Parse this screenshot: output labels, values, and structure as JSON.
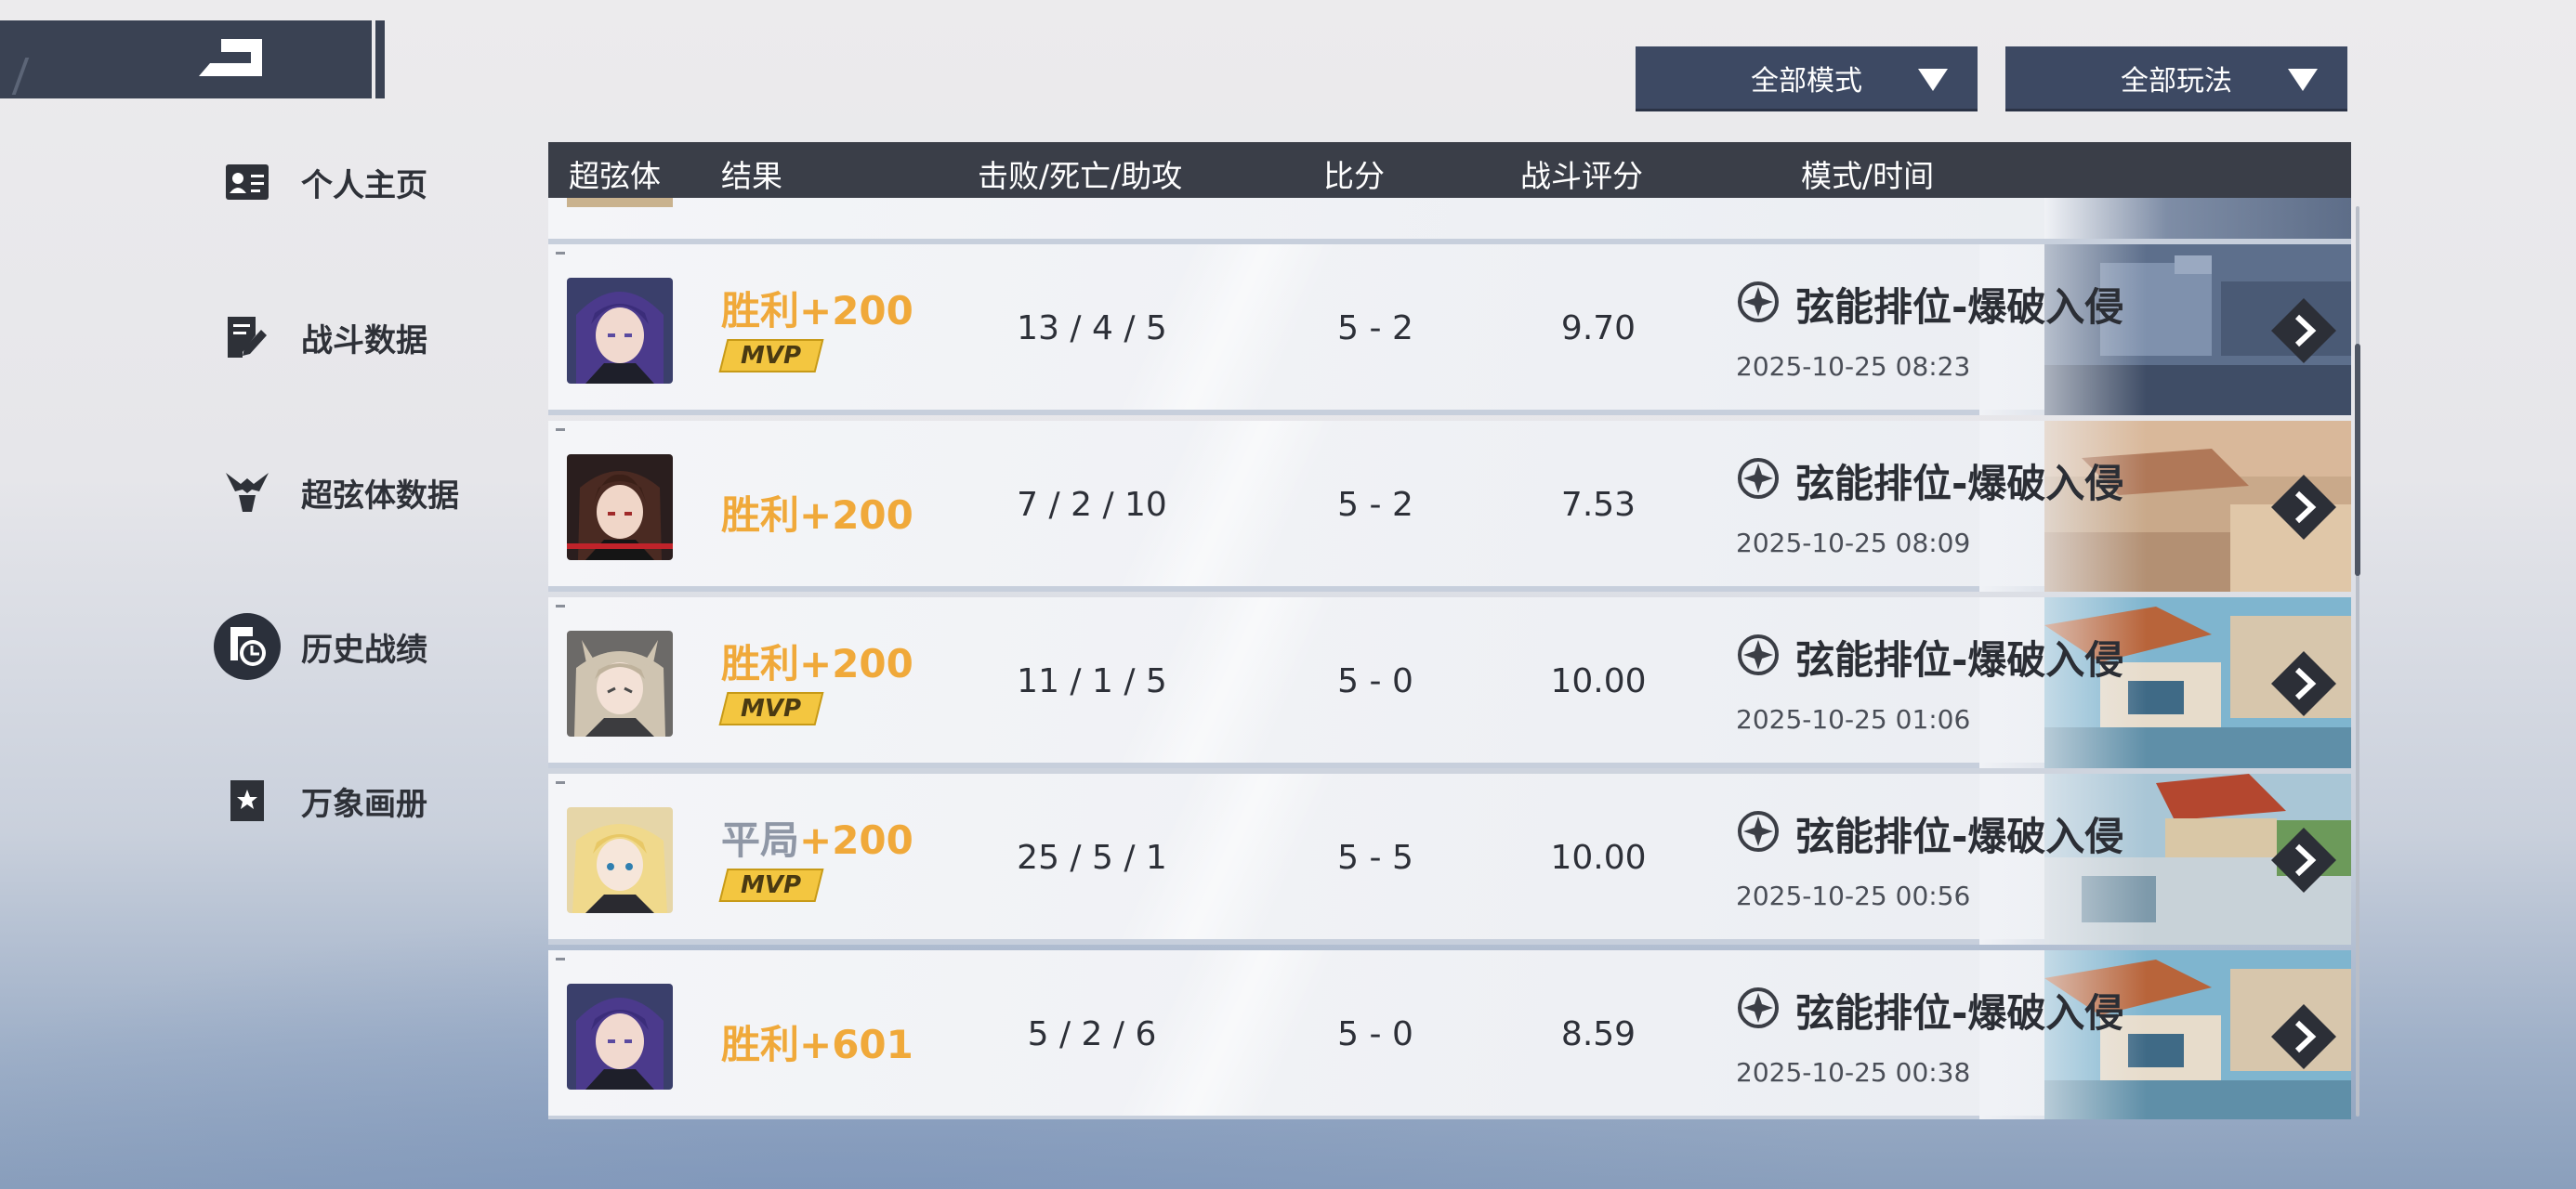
{
  "nav": {
    "items": [
      {
        "label": "个人主页",
        "icon": "id-card-icon"
      },
      {
        "label": "战斗数据",
        "icon": "note-pen-icon"
      },
      {
        "label": "超弦体数据",
        "icon": "superstring-icon"
      },
      {
        "label": "历史战绩",
        "icon": "history-clock-icon",
        "active": true
      },
      {
        "label": "万象画册",
        "icon": "star-book-icon"
      }
    ]
  },
  "filters": {
    "mode": "全部模式",
    "play": "全部玩法"
  },
  "table": {
    "headers": {
      "character": "超弦体",
      "result": "结果",
      "kda": "击败/死亡/助攻",
      "score": "比分",
      "rating": "战斗评分",
      "mode_time": "模式/时间"
    },
    "rows": [
      {
        "result_word": "胜利",
        "result_points": "+200",
        "outcome": "win",
        "mvp": true,
        "mvp_label": "MVP",
        "kda": "13 / 4 / 5",
        "score": "5 - 2",
        "rating": "9.70",
        "mode": "弦能排位-爆破入侵",
        "time": "2025-10-25 08:23"
      },
      {
        "result_word": "胜利",
        "result_points": "+200",
        "outcome": "win",
        "mvp": false,
        "kda": "7 / 2 / 10",
        "score": "5 - 2",
        "rating": "7.53",
        "mode": "弦能排位-爆破入侵",
        "time": "2025-10-25 08:09"
      },
      {
        "result_word": "胜利",
        "result_points": "+200",
        "outcome": "win",
        "mvp": true,
        "mvp_label": "MVP",
        "kda": "11 / 1 / 5",
        "score": "5 - 0",
        "rating": "10.00",
        "mode": "弦能排位-爆破入侵",
        "time": "2025-10-25 01:06"
      },
      {
        "result_word": "平局",
        "result_points": "+200",
        "outcome": "draw",
        "mvp": true,
        "mvp_label": "MVP",
        "kda": "25 / 5 / 1",
        "score": "5 - 5",
        "rating": "10.00",
        "mode": "弦能排位-爆破入侵",
        "time": "2025-10-25 00:56"
      },
      {
        "result_word": "胜利",
        "result_points": "+601",
        "outcome": "win",
        "mvp": false,
        "kda": "5 / 2 / 6",
        "score": "5 - 0",
        "rating": "8.59",
        "mode": "弦能排位-爆破入侵",
        "time": "2025-10-25 00:38"
      }
    ]
  },
  "colors": {
    "win": "#f0a93a",
    "draw": "#8f97a6",
    "header_bg": "#3a3e48",
    "filter_bg": "#3d4963",
    "mvp_badge": "#f3c640"
  }
}
